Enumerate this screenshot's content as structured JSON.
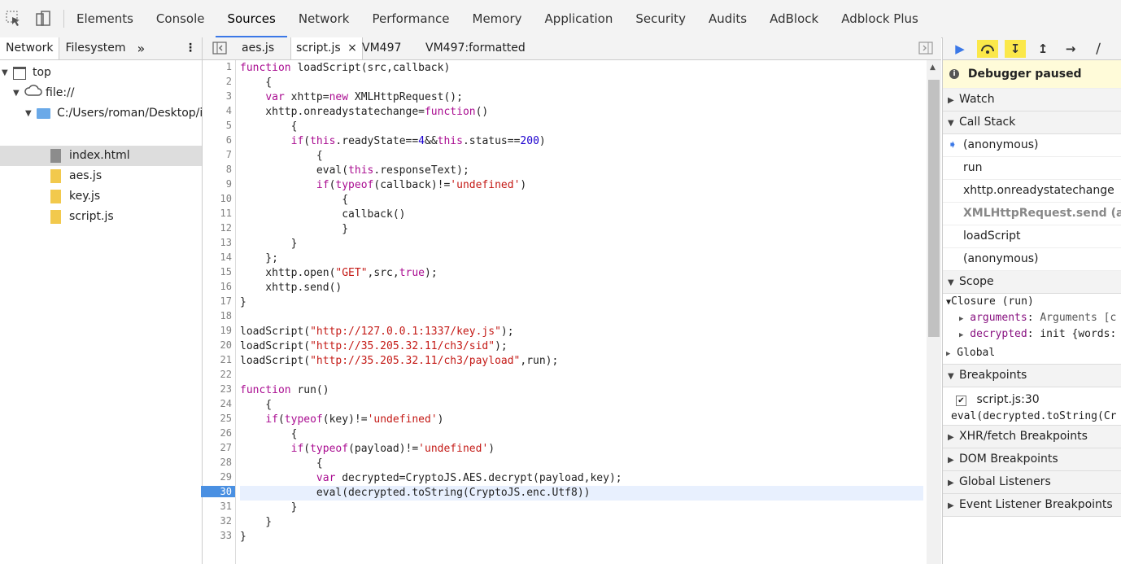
{
  "toolbar": {
    "inspect_icon": "cursor-arrow",
    "device_icon": "device-toggle",
    "tabs": [
      "Elements",
      "Console",
      "Sources",
      "Network",
      "Performance",
      "Memory",
      "Application",
      "Security",
      "Audits",
      "AdBlock",
      "Adblock Plus"
    ],
    "active_tab": "Sources"
  },
  "navigator": {
    "tabs": [
      "Network",
      "Filesystem"
    ],
    "more": "»",
    "menu": "⋮",
    "tree": [
      {
        "label": "top",
        "type": "frame"
      },
      {
        "label": "file://",
        "type": "origin"
      },
      {
        "label": "C:/Users/roman/Desktop/is",
        "type": "folder"
      },
      {
        "label": "index.html",
        "type": "file-html"
      },
      {
        "label": "aes.js",
        "type": "file-js"
      },
      {
        "label": "key.js",
        "type": "file-js"
      },
      {
        "label": "script.js",
        "type": "file-js"
      }
    ]
  },
  "editor": {
    "tabs": [
      "aes.js",
      "script.js",
      "VM497",
      "VM497:formatted"
    ],
    "active_tab": "script.js",
    "close_glyph": "×",
    "breakpoint_line": 30
  },
  "debugger": {
    "buttons": [
      "resume",
      "step-over",
      "step-into",
      "step-out",
      "step",
      "deactivate-breakpoints"
    ],
    "status": "Debugger paused",
    "sections": {
      "watch": "Watch",
      "call_stack": "Call Stack",
      "scope": "Scope",
      "breakpoints": "Breakpoints",
      "xhr": "XHR/fetch Breakpoints",
      "dom": "DOM Breakpoints",
      "global": "Global Listeners",
      "event": "Event Listener Breakpoints"
    },
    "call_stack": [
      "(anonymous)",
      "run",
      "xhttp.onreadystatechange",
      "XMLHttpRequest.send (asyn",
      "loadScript",
      "(anonymous)"
    ],
    "scope": {
      "closure": "Closure (run)",
      "arguments_key": "arguments",
      "arguments_val": "Arguments [c",
      "decrypted_key": "decrypted",
      "decrypted_val": "init {words:",
      "global": "Global"
    },
    "breakpoint_item": "script.js:30",
    "breakpoint_code": "eval(decrypted.toString(Cr"
  }
}
